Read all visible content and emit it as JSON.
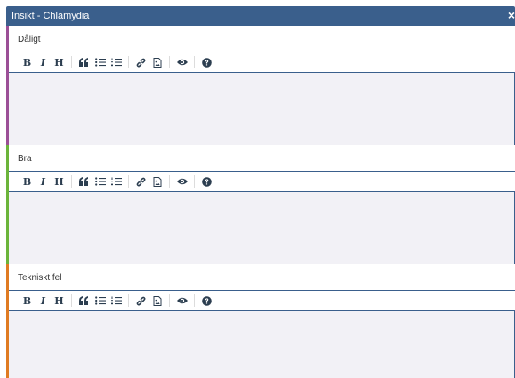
{
  "window": {
    "title": "Insikt - Chlamydia",
    "close_glyph": "×"
  },
  "toolbar": {
    "bold": "B",
    "italic": "I",
    "heading": "H",
    "icons": [
      "quote-icon",
      "unordered-list-icon",
      "ordered-list-icon",
      "link-icon",
      "image-icon",
      "preview-icon",
      "help-icon"
    ]
  },
  "sections": [
    {
      "label": "Dåligt",
      "accent": "#9b4f96",
      "value": ""
    },
    {
      "label": "Bra",
      "accent": "#6bb43a",
      "value": ""
    },
    {
      "label": "Tekniskt fel",
      "accent": "#e07b22",
      "value": ""
    }
  ],
  "colors": {
    "titlebar": "#3a5f8c",
    "editor_bg": "#f2f1f6"
  }
}
